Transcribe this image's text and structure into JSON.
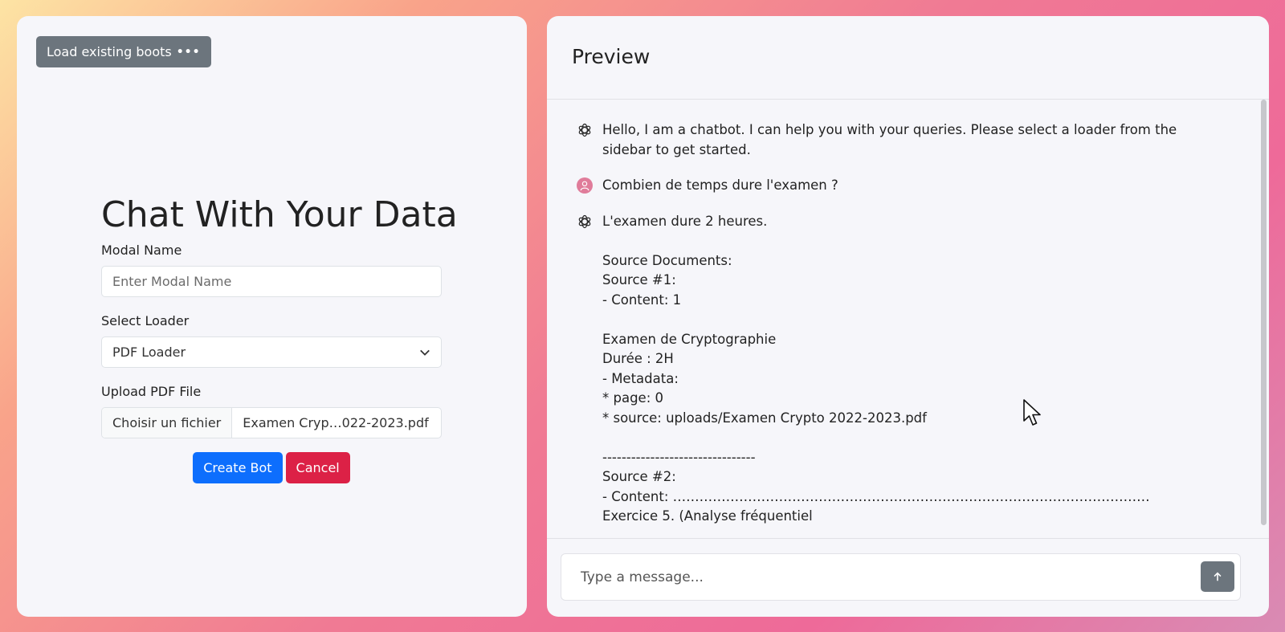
{
  "left_panel": {
    "load_button_label": "Load existing boots",
    "title": "Chat With Your Data",
    "modal_name_label": "Modal Name",
    "modal_name_placeholder": "Enter Modal Name",
    "select_loader_label": "Select Loader",
    "select_loader_value": "PDF Loader",
    "upload_label": "Upload PDF File",
    "choose_file_label": "Choisir un fichier",
    "file_name": "Examen Cryp…022-2023.pdf",
    "create_button": "Create Bot",
    "cancel_button": "Cancel"
  },
  "preview": {
    "title": "Preview",
    "messages": [
      {
        "role": "bot",
        "text": "Hello, I am a chatbot. I can help you with your queries. Please select a loader from the sidebar to get started."
      },
      {
        "role": "user",
        "text": "Combien de temps dure l'examen ?"
      },
      {
        "role": "bot",
        "text": "L'examen dure 2 heures.\n\nSource Documents:\nSource #1:\n- Content: 1\n\nExamen de Cryptographie\nDurée : 2H\n- Metadata:\n* page: 0\n* source: uploads/Examen Crypto 2022-2023.pdf\n\n--------------------------------\nSource #2:\n- Content: ………………………………………………………………………………………………\nExercice 5. (Analyse fréquentiel"
      }
    ],
    "input_placeholder": "Type a message..."
  },
  "icons": {
    "bot_avatar": "openai-logo-icon",
    "user_avatar": "user-icon",
    "send": "arrow-up-icon",
    "more": "ellipsis-icon",
    "dropdown": "chevron-down-icon"
  },
  "colors": {
    "primary": "#0d6efd",
    "danger": "#dc2146",
    "secondary": "#6c757d"
  }
}
